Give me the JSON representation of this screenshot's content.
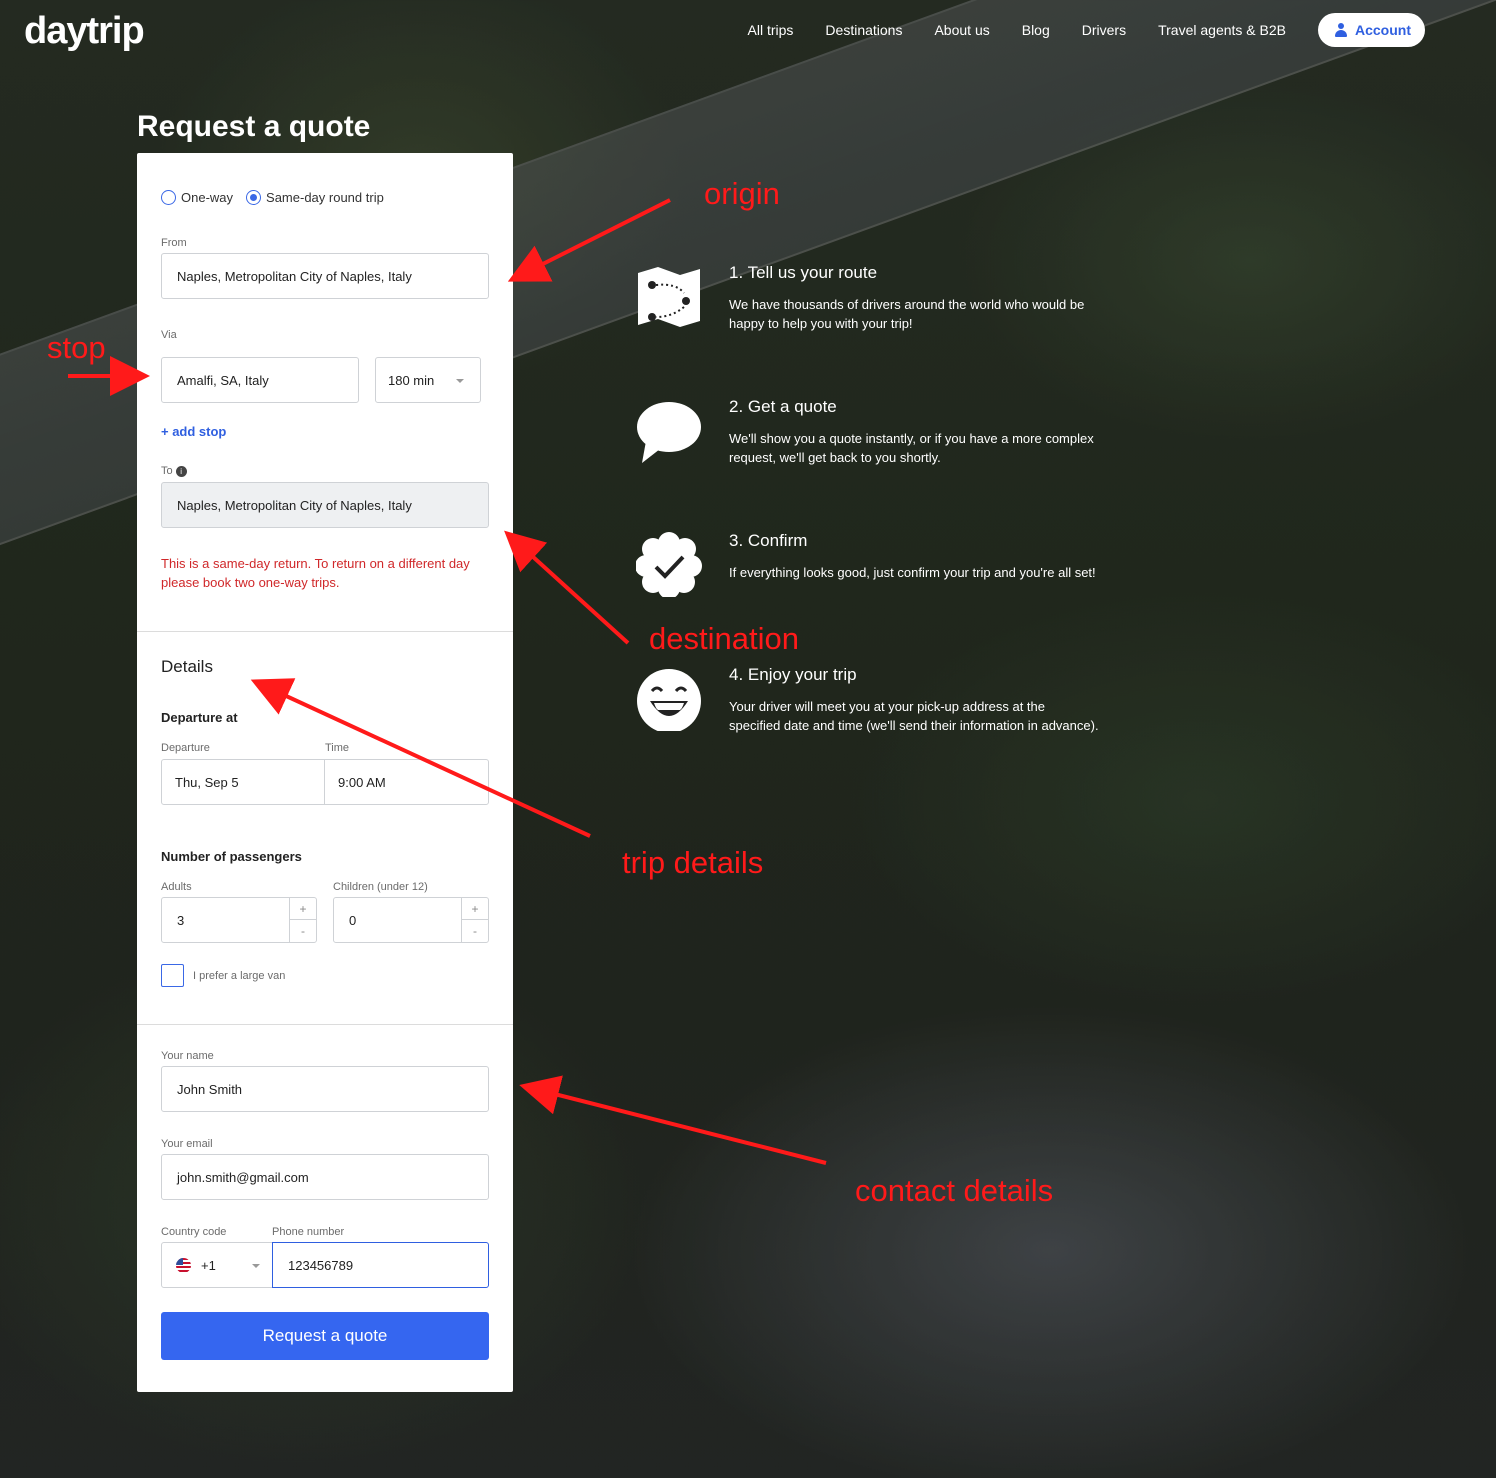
{
  "header": {
    "logo": "daytrip",
    "nav": [
      "All trips",
      "Destinations",
      "About us",
      "Blog",
      "Drivers",
      "Travel agents & B2B"
    ],
    "account_label": "Account"
  },
  "page_title": "Request a quote",
  "form": {
    "trip_types": [
      {
        "label": "One-way",
        "selected": false
      },
      {
        "label": "Same-day round trip",
        "selected": true
      }
    ],
    "from": {
      "label": "From",
      "value": "Naples, Metropolitan City of Naples, Italy"
    },
    "via": {
      "label": "Via",
      "value": "Amalfi, SA, Italy",
      "duration": "180 min"
    },
    "add_stop": "+ add stop",
    "to": {
      "label": "To",
      "value": "Naples, Metropolitan City of Naples, Italy",
      "info_icon": "i"
    },
    "error": "This is a same-day return. To return on a different day please book two one-way trips.",
    "details": {
      "heading": "Details",
      "departure_heading": "Departure at",
      "departure_label": "Departure",
      "departure_value": "Thu, Sep 5",
      "time_label": "Time",
      "time_value": "9:00 AM",
      "passengers_heading": "Number of passengers",
      "adults_label": "Adults",
      "adults_value": "3",
      "children_label": "Children (under 12)",
      "children_value": "0",
      "plus": "+",
      "minus": "-",
      "large_van_label": "I prefer a large van"
    },
    "contact": {
      "name_label": "Your name",
      "name_value": "John Smith",
      "email_label": "Your email",
      "email_value": "john.smith@gmail.com",
      "country_code_label": "Country code",
      "country_code_value": "+1",
      "phone_label": "Phone number",
      "phone_value": "123456789"
    },
    "submit_label": "Request a quote"
  },
  "steps": [
    {
      "title": "1. Tell us your route",
      "desc": "We have thousands of drivers around the world who would be happy to help you with your trip!",
      "icon": "map-route-icon"
    },
    {
      "title": "2. Get a quote",
      "desc": "We'll show you a quote instantly, or if you have a more complex request, we'll get back to you shortly.",
      "icon": "speech-bubble-icon"
    },
    {
      "title": "3. Confirm",
      "desc": "If everything looks good, just confirm your trip and you're all set!",
      "icon": "check-badge-icon"
    },
    {
      "title": "4. Enjoy your trip",
      "desc": "Your driver will meet you at your pick-up address at the specified date and time (we'll send their information in advance).",
      "icon": "smiley-icon"
    }
  ],
  "annotations": {
    "origin": "origin",
    "stop": "stop",
    "destination": "destination",
    "trip_details": "trip details",
    "contact_details": "contact details"
  },
  "colors": {
    "accent": "#3566f0",
    "error": "#d0282a",
    "annotation": "#ff1a1a"
  }
}
